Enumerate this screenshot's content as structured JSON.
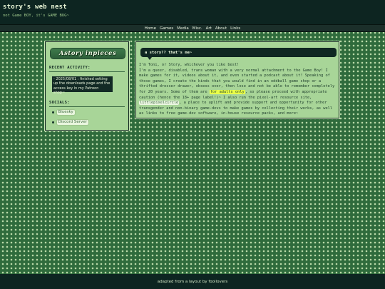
{
  "header": {
    "title": "story's web nest",
    "tagline": "not Game BOY, it's GAME BUG~"
  },
  "nav": {
    "items": [
      "Home",
      "Games",
      "Media",
      "Misc.",
      "Art",
      "About",
      "Links"
    ]
  },
  "sidebar": {
    "logo_text": "Astory inpieces",
    "recent_heading": "RECENT ACTIVITY:",
    "activity_text": "- 2025/08/01 : finished setting up the downloads page and the access key in my Patreon shop~",
    "socials_heading": "SOCIALS:",
    "socials": [
      "Bluesky",
      "Discord Server"
    ]
  },
  "main": {
    "bubble_title": "a story?? that's me~",
    "line1": "I'm Toni, or Story, whichever you like best!",
    "para_before": "I'm a queer, disabled, trans woman with a very normal attachment to the Game Boy! I make games for it, videos about it, and even started a podcast about it! Speaking of those games, I create the kinds that you would find in an oddball game shop or a thrifted dresser drawer, obsess over, then lose and not be able to remember completely for 20 years. Some of them are ",
    "highlight": "for adults only",
    "para_middle": ", so please proceed with appropriate caution (hence the 18+ page label!)~ I also run the pixel-art resource site, ",
    "chip": "littlepixelcircle",
    "para_after": ", a place to uplift and provide support and opportunity for other transgender and non-binary game-devs to make games by collecting their works, as well as links to free game-dev software, in-house resource packs, and more~"
  },
  "footer": {
    "text": "adapted from a layout by foollovers"
  },
  "colors": {
    "background": "#2f6b3c",
    "dots": "#b9d9a8",
    "header": "#0d2521",
    "panel": "#a8d598",
    "highlight": "#e9ff4a"
  }
}
